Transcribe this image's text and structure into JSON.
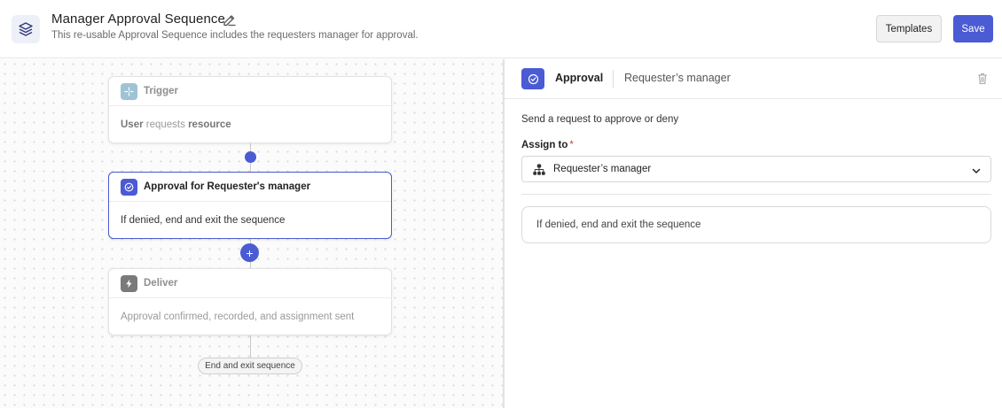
{
  "header": {
    "title": "Manager Approval Sequence",
    "subtitle": "This re-usable Approval Sequence includes the requesters manager for approval.",
    "templates_label": "Templates",
    "save_label": "Save",
    "icons": {
      "app": "layers-icon",
      "edit": "pencil-icon"
    }
  },
  "canvas": {
    "trigger": {
      "title": "Trigger",
      "body_parts": [
        "User",
        " requests ",
        "resource"
      ],
      "icon": "sparkle-icon",
      "badge_color": "#9ec3d4"
    },
    "approval": {
      "title": "Approval for Requester's manager",
      "body": "If denied, end and exit the sequence",
      "icon": "check-circle-icon",
      "badge_color": "#4a5bd4",
      "selected": true
    },
    "deliver": {
      "title": "Deliver",
      "body": "Approval confirmed, recorded, and assignment sent",
      "icon": "bolt-icon",
      "badge_color": "#7a7a7a"
    },
    "add_step_symbol": "+",
    "end_label": "End and exit sequence"
  },
  "panel": {
    "title": "Approval",
    "subtitle": "Requester’s manager",
    "description": "Send a request to approve or deny",
    "assign_label": "Assign to",
    "required_mark": "*",
    "assign_value": "Requester’s manager",
    "outcome": "If denied, end and exit the sequence",
    "icons": {
      "badge": "check-circle-icon",
      "delete": "trash-icon",
      "select": "org-chart-icon",
      "dropdown": "chevron-down-icon"
    }
  },
  "colors": {
    "accent": "#4a5bd4",
    "required": "#d63a3a"
  }
}
